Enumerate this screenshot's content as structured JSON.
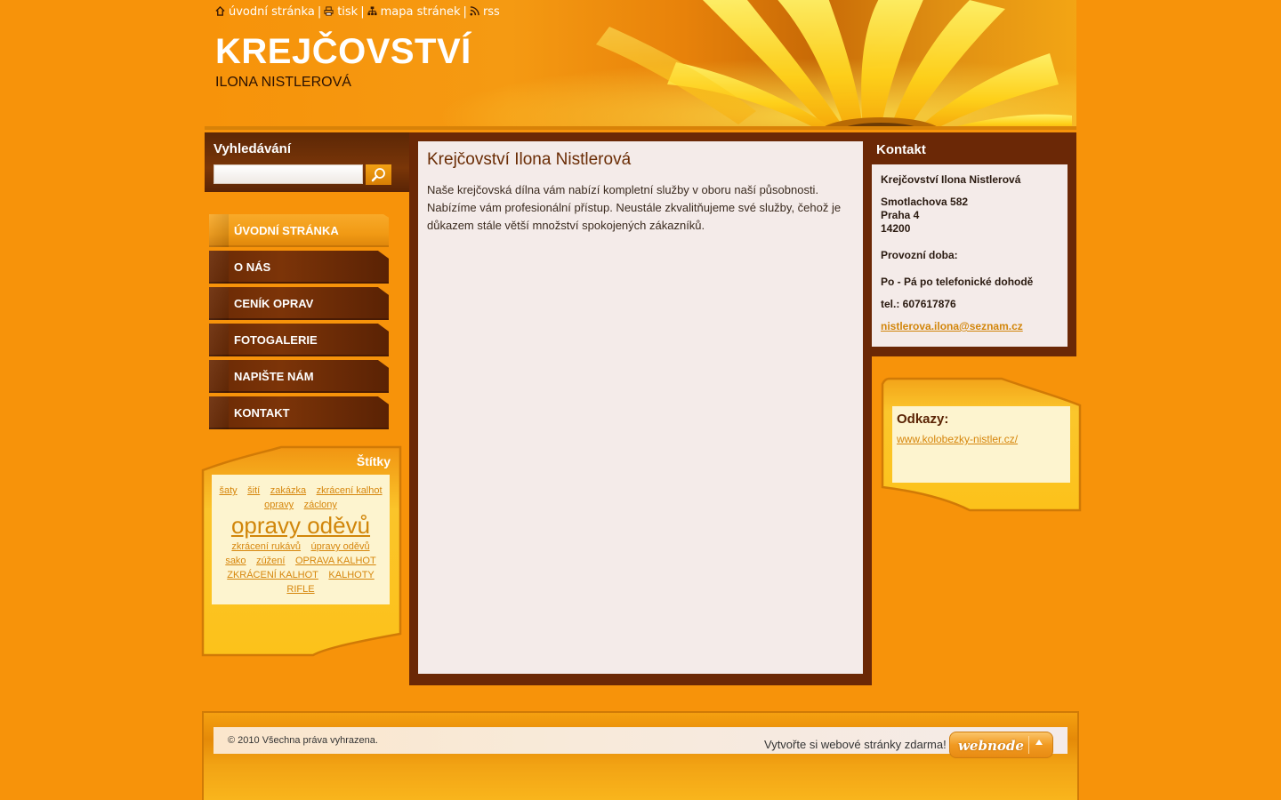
{
  "topnav": {
    "items": [
      {
        "label": "úvodní stránka",
        "icon": "home-icon"
      },
      {
        "label": "tisk",
        "icon": "printer-icon"
      },
      {
        "label": "mapa stránek",
        "icon": "sitemap-icon"
      },
      {
        "label": "rss",
        "icon": "rss-icon"
      }
    ],
    "separator": "|"
  },
  "header": {
    "title": "KREJČOVSTVÍ",
    "subtitle": "ILONA NISTLEROVÁ"
  },
  "search": {
    "title": "Vyhledávání",
    "placeholder": "",
    "value": "",
    "button_icon": "magnifier-icon"
  },
  "menu": {
    "items": [
      {
        "label": "ÚVODNÍ STRÁNKA",
        "active": true
      },
      {
        "label": "O NÁS",
        "active": false
      },
      {
        "label": "CENÍK OPRAV",
        "active": false
      },
      {
        "label": "FOTOGALERIE",
        "active": false
      },
      {
        "label": "NAPIŠTE NÁM",
        "active": false
      },
      {
        "label": "KONTAKT",
        "active": false
      }
    ]
  },
  "tags": {
    "title": "Štítky",
    "items": [
      "šaty",
      "šití",
      "zakázka",
      "zkrácení kalhot",
      "opravy",
      "záclony",
      "opravy oděvů",
      "zkrácení rukávů",
      "úpravy oděvů",
      "sako",
      "zúžení",
      "OPRAVA KALHOT",
      "ZKRÁCENÍ KALHOT",
      "KALHOTY",
      "RIFLE"
    ]
  },
  "content": {
    "heading": "Krejčovství Ilona Nistlerová",
    "paragraph": "Naše krejčovská dílna vám nabízí kompletní služby v oboru naší působnosti. Nabízíme vám profesionální přístup. Neustále zkvalitňujeme své služby, čehož je důkazem stále větší množství spokojených zákazníků."
  },
  "contact": {
    "title": "Kontakt",
    "company": "Krejčovství Ilona Nistlerová",
    "street": "Smotlachova 582",
    "city": "Praha 4",
    "zip": "14200",
    "hours_label": "Provozní doba:",
    "hours": "Po - Pá po telefonické dohodě",
    "phone": "tel.: 607617876",
    "email": "nistlerova.ilona@seznam.cz"
  },
  "links": {
    "title": "Odkazy:",
    "url": "www.kolobezky-nistler.cz/"
  },
  "footer": {
    "copyright": "© 2010 Všechna práva vyhrazena.",
    "promo": "Vytvořte si webové stránky zdarma!",
    "brand": "webnode"
  },
  "colors": {
    "background": "#f7930a",
    "dark_brown": "#6b2806",
    "panel": "#f4ebe9",
    "cream": "#fdf4cf",
    "link": "#d6860c"
  }
}
